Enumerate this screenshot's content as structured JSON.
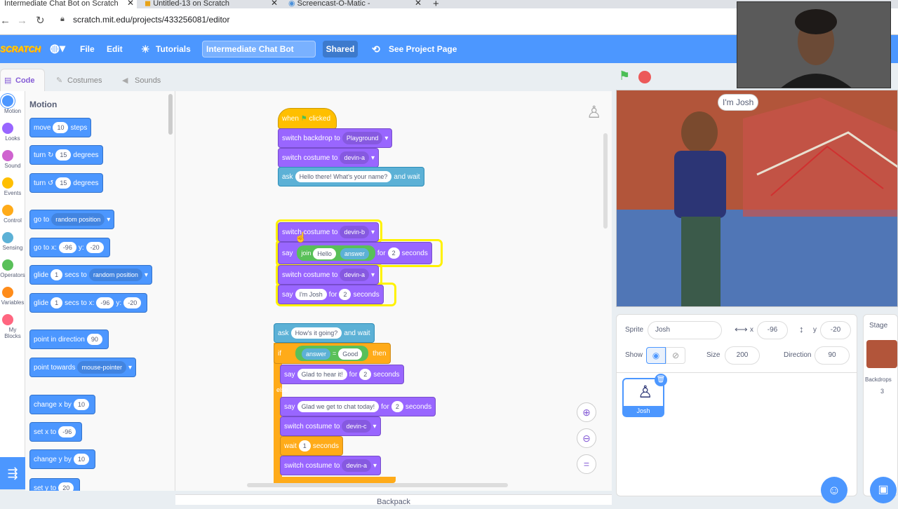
{
  "browser": {
    "tabs": [
      "Intermediate Chat Bot on Scratch",
      "Untitled-13 on Scratch",
      "Screencast-O-Matic -"
    ],
    "url": "scratch.mit.edu/projects/433256081/editor"
  },
  "menubar": {
    "logo": "SCRATCH",
    "file": "File",
    "edit": "Edit",
    "tutorials": "Tutorials",
    "project_title": "Intermediate Chat Bot",
    "shared": "Shared",
    "see_project": "See Project Page"
  },
  "editor_tabs": {
    "code": "Code",
    "costumes": "Costumes",
    "sounds": "Sounds"
  },
  "categories": [
    {
      "label": "Motion",
      "color": "#4c97ff"
    },
    {
      "label": "Looks",
      "color": "#9966ff"
    },
    {
      "label": "Sound",
      "color": "#cf63cf"
    },
    {
      "label": "Events",
      "color": "#ffbf00"
    },
    {
      "label": "Control",
      "color": "#ffab19"
    },
    {
      "label": "Sensing",
      "color": "#5cb1d6"
    },
    {
      "label": "Operators",
      "color": "#59c059"
    },
    {
      "label": "Variables",
      "color": "#ff8c1a"
    },
    {
      "label": "My Blocks",
      "color": "#ff6680"
    }
  ],
  "palette": {
    "heading": "Motion",
    "move": "move",
    "move_n": "10",
    "steps": "steps",
    "turn": "turn",
    "degrees": "degrees",
    "turn_cw_n": "15",
    "turn_ccw_n": "15",
    "go_to": "go to",
    "random_position": "random position",
    "go_to_x": "go to x:",
    "x_val": "-96",
    "y_label": "y:",
    "y_val": "-20",
    "glide": "glide",
    "secs_to": "secs to",
    "glide_n": "1",
    "secs_to_x": "secs to x:",
    "point_dir": "point in direction",
    "dir_val": "90",
    "point_towards": "point towards",
    "mouse_pointer": "mouse-pointer",
    "change_x": "change x by",
    "change_x_val": "10",
    "set_x": "set x to",
    "set_x_val": "-96",
    "change_y": "change y by",
    "change_y_val": "10",
    "set_y": "set y to",
    "set_y_val": "20"
  },
  "script": {
    "when": "when",
    "clicked": "clicked",
    "switch_backdrop": "switch backdrop to",
    "playground": "Playground",
    "switch_costume": "switch costume to",
    "devin_a": "devin-a",
    "devin_b": "devin-b",
    "devin_c": "devin-c",
    "ask": "ask",
    "ask1": "Hello there! What's  your name?",
    "and_wait": "and wait",
    "say": "say",
    "join": "join",
    "hello": "Hello",
    "answer": "answer",
    "for": "for",
    "two": "2",
    "seconds": "seconds",
    "im_josh": "I'm Josh",
    "ask2": "How's it going?",
    "if": "if",
    "equals": "=",
    "good": "Good",
    "then": "then",
    "else": "else",
    "glad1": "Glad to hear it!",
    "glad2": "Glad we get to chat today!",
    "wait": "wait",
    "one": "1"
  },
  "stage": {
    "speech": "I'm Josh"
  },
  "sprite_info": {
    "sprite_label": "Sprite",
    "sprite_name": "Josh",
    "x_label": "x",
    "x": "-96",
    "y_label": "y",
    "y": "-20",
    "show_label": "Show",
    "size_label": "Size",
    "size": "200",
    "direction_label": "Direction",
    "direction": "90",
    "thumb_name": "Josh"
  },
  "stage_panel": {
    "label": "Stage",
    "backdrops_label": "Backdrops",
    "backdrops_count": "3"
  },
  "backpack": "Backpack",
  "colors": {
    "accent": "#4c97ff",
    "motion": "#4c97ff",
    "looks": "#9966ff",
    "events": "#ffbf00",
    "control": "#ffab19",
    "sensing": "#5cb1d6",
    "operators": "#59c059"
  }
}
